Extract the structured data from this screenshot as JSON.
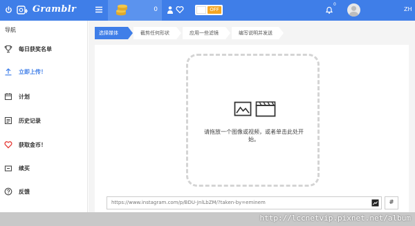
{
  "topbar": {
    "logo_text": "Gramblr",
    "coin_count": "0",
    "toggle_label": "OFF",
    "notification_count": "0",
    "user_code": "ZH"
  },
  "sidebar": {
    "title": "导航",
    "items": [
      {
        "label": "每日获奖名单",
        "icon": "trophy-icon"
      },
      {
        "label": "立即上传！",
        "icon": "upload-icon"
      },
      {
        "label": "计划",
        "icon": "calendar-icon"
      },
      {
        "label": "历史记录",
        "icon": "history-icon"
      },
      {
        "label": "获取金币！",
        "icon": "heart-icon"
      },
      {
        "label": "续买",
        "icon": "cart-icon"
      },
      {
        "label": "反馈",
        "icon": "help-icon"
      }
    ]
  },
  "steps": [
    "选择媒体",
    "截剪任何形状",
    "应用一些滤镜",
    "编写说明并发送"
  ],
  "dropzone": {
    "text": "请拖放一个图像或视频，或者单击此处开始。"
  },
  "url_input": {
    "value": "https://www.instagram.com/p/BDU-JnlLbZM/?taken-by=eminem"
  },
  "hash_button": "#",
  "watermark": "http://lccnetvip.pixnet.net/album",
  "colors": {
    "primary": "#3f7ee8",
    "coin_box": "#5b93ee",
    "toggle_off": "#f5a623",
    "heart": "#e53935"
  }
}
